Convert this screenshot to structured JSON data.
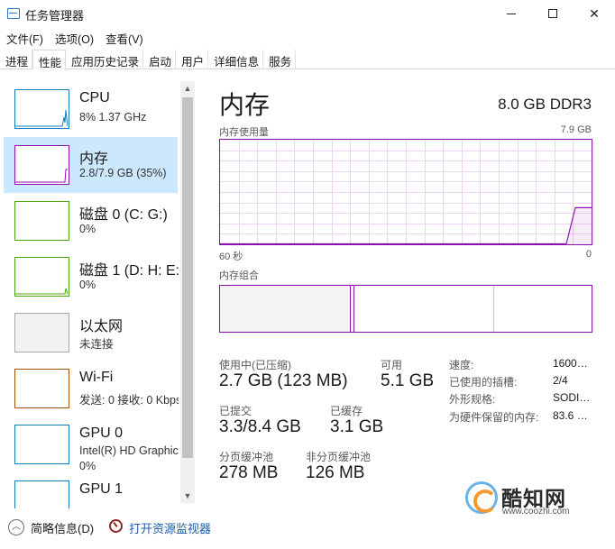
{
  "window": {
    "title": "任务管理器"
  },
  "menu": [
    "文件(F)",
    "选项(O)",
    "查看(V)"
  ],
  "tabs": [
    {
      "label": "进程",
      "active": false
    },
    {
      "label": "性能",
      "active": true
    },
    {
      "label": "应用历史记录",
      "active": false
    },
    {
      "label": "启动",
      "active": false
    },
    {
      "label": "用户",
      "active": false
    },
    {
      "label": "详细信息",
      "active": false
    },
    {
      "label": "服务",
      "active": false
    }
  ],
  "sidebar": {
    "items": [
      {
        "name": "CPU",
        "sub": "8% 1.37 GHz",
        "color": "#117dbb"
      },
      {
        "name": "内存",
        "sub": "2.8/7.9 GB (35%)",
        "color": "#8b12ae",
        "selected": true
      },
      {
        "name": "磁盘 0 (C: G:)",
        "sub": "0%",
        "color": "#4da60c"
      },
      {
        "name": "磁盘 1 (D: H: E:",
        "sub": "0%",
        "color": "#4da60c"
      },
      {
        "name": "以太网",
        "sub": "未连接",
        "color": "#a6a6a6"
      },
      {
        "name": "Wi-Fi",
        "sub": "发送: 0 接收: 0 Kbps",
        "color": "#a74f01"
      },
      {
        "name": "GPU 0",
        "sub": "Intel(R) HD Graphics",
        "sub2": "0%",
        "color": "#117dbb"
      },
      {
        "name": "GPU 1",
        "sub": "",
        "color": "#117dbb"
      }
    ]
  },
  "main": {
    "title": "内存",
    "spec": "8.0 GB DDR3",
    "graph_label": "内存使用量",
    "graph_max": "7.9 GB",
    "axis_left": "60 秒",
    "axis_right": "0",
    "composition_label": "内存组合",
    "stats": {
      "in_use_label": "使用中(已压缩)",
      "in_use_value": "2.7 GB (123 MB)",
      "available_label": "可用",
      "available_value": "5.1 GB",
      "committed_label": "已提交",
      "committed_value": "3.3/8.4 GB",
      "cached_label": "已缓存",
      "cached_value": "3.1 GB",
      "paged_label": "分页缓冲池",
      "paged_value": "278 MB",
      "nonpaged_label": "非分页缓冲池",
      "nonpaged_value": "126 MB"
    },
    "details": [
      {
        "key": "速度:",
        "value": "1600…"
      },
      {
        "key": "已使用的插槽:",
        "value": "2/4"
      },
      {
        "key": "外形规格:",
        "value": "SODI…"
      },
      {
        "key": "为硬件保留的内存:",
        "value": "83.6 …"
      }
    ],
    "usage_fraction": 0.35
  },
  "footer": {
    "brief_label": "简略信息(D)",
    "monitor_label": "打开资源监视器"
  },
  "watermark": {
    "name": "酷知网",
    "url": "www.coozhi.com"
  }
}
